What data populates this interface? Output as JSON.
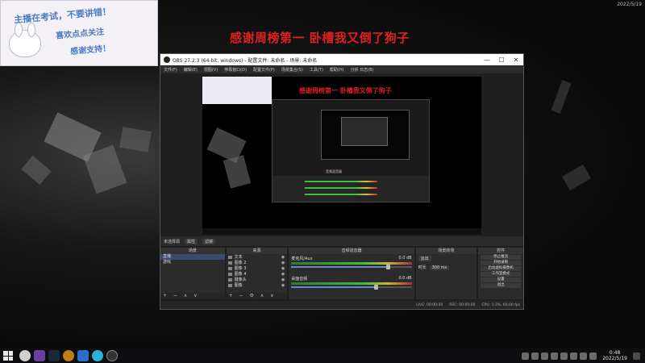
{
  "overlay": {
    "headline": "感谢周榜第一 卧槽我又倒了狗子",
    "card_lines": [
      "主播在考试，不要讲错！",
      "喜欢点点关注",
      "感谢支持！"
    ],
    "corner_date": "2022/5/19"
  },
  "obs": {
    "title": "OBS 27.2.3 (64-bit, windows) - 配置文件: 未命名 - 场景: 未命名",
    "window_controls": [
      "—",
      "☐",
      "✕"
    ],
    "menu": [
      "文件(F)",
      "编辑(E)",
      "视图(V)",
      "停靠窗口(D)",
      "配置文件(P)",
      "场景集合(S)",
      "工具(T)",
      "帮助(H)",
      "分析 日志(B)"
    ],
    "preview": {
      "headline": "感谢周榜第一 卧槽我又倒了狗子",
      "nested_mixer_title": "音频混音器"
    },
    "status_row": {
      "label": "未选择源",
      "properties": "属性",
      "filters": "滤镜"
    },
    "docks": {
      "scenes": {
        "title": "场景",
        "items": [
          "直播",
          "游戏"
        ],
        "footer": "+ − ∧ ∨"
      },
      "sources": {
        "title": "来源",
        "items": [
          "文本",
          "图像 2",
          "图像 3",
          "图像 4",
          "摄像头",
          "图像",
          "文字"
        ],
        "footer": "+ − ⚙ ∧ ∨"
      },
      "mixer": {
        "title": "音频混音器",
        "channels": [
          {
            "name": "麦克风/Aux",
            "level": "0.0 dB",
            "volume": 0.8
          },
          {
            "name": "桌面音频",
            "level": "0.0 dB",
            "volume": 0.7
          }
        ]
      },
      "transitions": {
        "title": "场景转场",
        "type_label": "淡出",
        "duration_label": "时长",
        "duration_value": "300 ms"
      },
      "controls": {
        "title": "控件",
        "buttons": [
          "停止推流",
          "开始录制",
          "启动虚拟摄像机",
          "工作室模式",
          "设置",
          "退出"
        ]
      }
    },
    "statusbar": {
      "live": "LIVE: 00:00:00",
      "rec": "REC: 00:00:00",
      "cpu": "CPU: 1.3%, 60.00 fps"
    }
  },
  "taskbar": {
    "time": "0:48",
    "date": "2022/5/19"
  }
}
